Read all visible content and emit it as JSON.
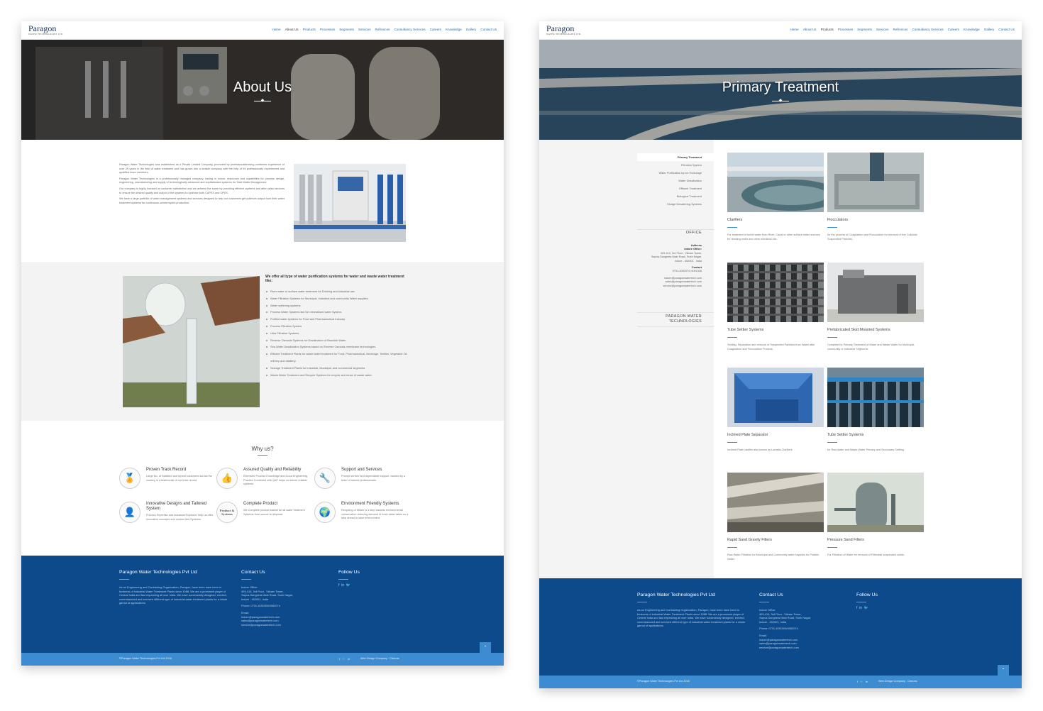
{
  "nav": [
    "Home",
    "About Us",
    "Products",
    "Processes",
    "Segments",
    "Services",
    "Refrences",
    "Consultancy Services",
    "Careers",
    "Knowledge",
    "Gallery",
    "Contact Us"
  ],
  "logo": {
    "name": "Paragon",
    "tag": "WATER TECHNOLOGIES LTD"
  },
  "about": {
    "hero_title": "About Us",
    "paragraphs": [
      "Paragon Water Technologies was established as a Private Limited Company, promoted by professionalshaving combined experience of over 25 years in the field of water treatment and has grown into a sizable company with the help of its professionally experienced and qualified team members.",
      "Paragon Water Technologies is a professionally managed company, having in house, resources and capabilities for process design, engineering, manufacturing and supply of technologically advanced and sophisticated systems for Total Water Management.",
      "Our company is highly focused on customer satisfaction and we achieve the same by providing efficient systems and after sales services to ensure the desired quality and output of the systems to optimize both CAPEX and OPEX.",
      "We have a large portfolio of water management systems and services designed to help our customers get optimum output from their water treatment systems for continuous uninterrupted production."
    ],
    "offer_title": "We offer all type of water purification systems for water and waste water treatment like:",
    "offer_items": [
      "River water or surface water treatment for Drinking and industrial use.",
      "Water Filtration Systems for Municipal, Industrial and community Water supplies.",
      "Water softening systems.",
      "Process Water Systems like De mineralised water System.",
      "Purified water systems for Food and Pharmaceutical Industry.",
      "Process Filtration System.",
      "Ultra Filtration Systems.",
      "Reverse Osmosis Systems for Desalination of Brackish Water.",
      "Sea Water Desalination Systems based on Reverse Osmosis membrane technologies.",
      "Effluent Treatment Plants for waste water treatment for Food, Pharmaceutical, Beverage, Textiles, Vegetable Oil refinery and distillery.",
      "Sewage Treatment Plants for Industrial, Municipal, and commercial segments.",
      "Waste Water Treatment and Recycle Systems for recycle and reuse of waste water."
    ],
    "why_title": "Why us?",
    "why_items": [
      {
        "title": "Proven Track Record",
        "desc": "Large No. of Satisfied and repeat customers across the country, is a testimonial of our track record.",
        "icon": "award-icon",
        "glyph": "🏅"
      },
      {
        "title": "Assured Quality and Reliability",
        "desc": "Extensive Process Knowledge and Good Engineering Practice Combined with QAP helps us deliver reliable systems.",
        "icon": "quality-icon",
        "glyph": "👍"
      },
      {
        "title": "Support and Services",
        "desc": "Prompt service and dependable support, backed by a team of trained professionals.",
        "icon": "tools-icon",
        "glyph": "🔧"
      },
      {
        "title": "Innovative Designs and Tailored System",
        "desc": "Process Expertise and Industrial Exposure Help us offer innovative concepts and custom fied Systems.",
        "icon": "head-icon",
        "glyph": "👤"
      },
      {
        "title": "Complete Product",
        "desc": "We Complete product basket for all water treatment Systems from source to disposal.",
        "icon": "product-systems-icon",
        "glyph": "Product & Systems"
      },
      {
        "title": "Environment Friendly Systems",
        "desc": "Recycling of Waste is a step towards environmental conservation reducing demand of fresh water takes us a step ahead to save environment.",
        "icon": "globe-icon",
        "glyph": "🌍"
      }
    ]
  },
  "primary": {
    "hero_title": "Primary Treatment",
    "side_menu": [
      "Primary Treatment",
      "Filtration System",
      "Water Purification by ion Exchange",
      "Water Desalination",
      "Effluent Treatment",
      "Biological Treatment",
      "Sludge Dewatering Systems"
    ],
    "office": {
      "heading": "OFFICE",
      "address_label": "Address",
      "office_label": "Indore Office:",
      "address": [
        "409-410, 3rd Floor , Vikram Tower,",
        "Sapna-Sangeeta Main Road, Sneh Nagar,",
        "Indore - 452001 , India"
      ],
      "contact_label": "Contact",
      "phone": "0731-4082074 /4091308",
      "emails": [
        "indore@paragonwatertech.com",
        "sales@paragonwatertech.com",
        "service@paragonwatertech.com"
      ]
    },
    "company_heading": "PARAGON WATER TECHNOLOGIES",
    "cards": [
      {
        "title": "Clarifiers",
        "desc": "For treatment of turbid water from River, Canal or other surface water sources for drinking water and other industrial use."
      },
      {
        "title": "Flocculators",
        "desc": "for the process of Coagulation and Flocculation for removal of fine Colloidal Suspended Particles."
      },
      {
        "title": "Tube Settler Systems",
        "desc": "Settling, Separation and removal of Suspended Particles from Water after Coagulation and Flocculation Process."
      },
      {
        "title": "Prefabricated Skid Mounted Systems",
        "desc": "Complete for Primary Treatment of Water and Waste Water for Municipal, community or Industrial Segments"
      },
      {
        "title": "Inclined Plate Separator",
        "desc": "Inclined Plate clarifier also known as Lamella Clarifiers"
      },
      {
        "title": "Tube Settler Systems",
        "desc": "for Raw water and Waste Water Primary and Secondary Settling"
      },
      {
        "title": "Rapid Sand Gravity Filters",
        "desc": "Raw Water Filtration for Municipal and Community water supplies for Potable Water."
      },
      {
        "title": "Pressure Sand Filters",
        "desc": "For Filtration of Water for removal of Filterable suspended solids."
      }
    ]
  },
  "footer": {
    "company_title": "Paragon Water Technologies Pvt Ltd",
    "company_desc": "As an Engineering and Contracting Organization, Paragon, have been have been in business of industrial Water Treatment Plants since 1988. We are a prominent player of Central India and fast expanding all over India. We have successfully designed, erected, commissioned and serviced different type of industrial water treatment plants for a whole gamut of applications.",
    "contact_title": "Contact Us",
    "contact_lines": [
      "Indore Office:",
      "409-410, 3rd Floor , Vikram Tower,",
      "Sapna-Sangeeta Main Road, Sneh Nagar,",
      "Indore - 452001, India"
    ],
    "phone": "Phone: 0731-4091308/4082074",
    "email_label": "Email:",
    "emails": [
      "indore@paragonwatertech.com",
      "sales@paragonwatertech.com",
      "service@paragonwatertech.com"
    ],
    "follow_title": "Follow Us",
    "copyright": "©Paragon Water Technologies Pvt Ltd 2016",
    "credit": "Web Design Company : Clictons"
  },
  "colors": {
    "footer": "#0c4a8c",
    "bar": "#3d8bd0",
    "link": "#2f69a8"
  }
}
